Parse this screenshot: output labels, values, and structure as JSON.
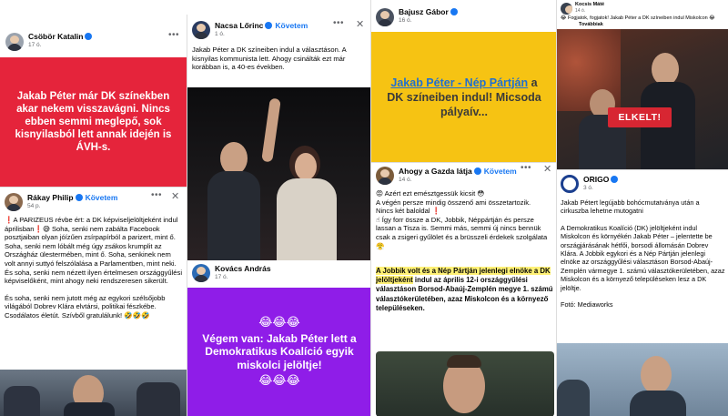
{
  "posts": {
    "csobor": {
      "author": "Csöbör Katalin",
      "time": "17 ó.",
      "card_text": "Jakab Péter már DK színekben akar nekem visszavágni. Nincs ebben semmi meglepő, sok kisnyilasból lett annak idején is ÁVH-s.",
      "card_color": "#e5243b"
    },
    "rakay": {
      "author": "Rákay Philip",
      "follow": "Követem",
      "time": "54 p.",
      "paragraphs": [
        "❗A PARIZEUS révbe ért: a DK képviseljelöltjeként indul áprilisban❗😅 Soha, senki nem zabálta Facebook posztjaiban olyan jóízűen zsírpapírból a parizert, mint ő. Soha, senki nem lóbált még úgy zsákos krumplit az Országház ülestermében, mint ő. Soha, senkinek nem volt annyi suttyó felszólalása a Parlamentben, mint neki. És soha, senki nem nézett ilyen értelmesen országgyűlési képviselőként, mint ahogy neki rendszeresen sikerült.",
        "És soha, senki nem jutott még az egykori szélsőjobb világából Dobrev Klára elvtársi, politikai fészkébe. Csodálatos életút. Szívből gratulálunk! 🤣🤣🤣"
      ]
    },
    "nacsa": {
      "author": "Nacsa Lőrinc",
      "follow": "Követem",
      "time": "1 ó.",
      "text": "Jakab Péter a DK színeiben indul a választáson. A kisnyilas kommunista lett. Ahogy csinálták ezt már korábban is, a 40-es években."
    },
    "kovacs": {
      "author": "Kovács András",
      "time": "17 ó.",
      "card_emoji_top": "😂😂😂",
      "card_text": "Végem van: Jakab Péter lett a Demokratikus Koalíció egyik miskolci jelöltje!",
      "card_emoji_bottom": "😂😂😂",
      "card_color": "#8f1de8"
    },
    "bajusz": {
      "author": "Bajusz Gábor",
      "time": "16 ó.",
      "card_part1": "Jakab Péter - Nép Pártján",
      "card_part2": " a DK színeiben indul! Micsoda pályaív...",
      "card_color": "#f6c313"
    },
    "gazda": {
      "author": "Ahogy a Gazda látja",
      "follow": "Követem",
      "time": "14 ó.",
      "lines": [
        "😡 Azért ezt emésztgessük kicsit 😳",
        "A végén persze mindig összenő ami összetartozik.",
        "Nincs két baloldal ❗",
        "☝ Így forr össze a DK, Jobbik, Néppártján és persze lassan a Tisza is. Semmi más, semmi új nincs bennük csak a zsigeri gyűlölet és a brüsszeli érdekek szolgálata 😤"
      ],
      "card_highlight": "A Jobbik volt és a Nép Pártján jelenlegi elnöke a DK jelöltjeként",
      "card_text": " indul az április 12-i országgyűlési választáson Borsod-Abaúj-Zemplén megye 1. számú választókerületében, azaz Miskolcon és a környező településeken."
    },
    "kocsis": {
      "author": "Kocsis Máté",
      "time": "14 ó.",
      "text": "😂 Fogjatok, fogjatok! Jakab Péter a DK színeiben indul Miskolcon 😂",
      "more": "Továbbiak",
      "photo_caption": "ELKELT!"
    },
    "origo": {
      "author": "ORIGO",
      "time": "3 ó.",
      "p1": "Jakab Pétert legújabb bohócmutatványa után a cirkuszba lehetne mutogatni",
      "p2": "A Demokratikus Koalíció (DK) jelöltjeként indul Miskolcon és környékén Jakab Péter – jelentette be országjárásának hétfői, borsodi állomásán Dobrev Klára. A Jobbik egykori és a Nép Pártján jelenlegi elnöke az országgyűlési választáson Borsod-Abaúj-Zemplén vármegye 1. számú választókerületében, azaz Miskolcon és a környező településeken lesz a DK jelöltje.",
      "credit": "Fotó: Mediaworks"
    }
  },
  "colors": {
    "accent": "#1877f2",
    "verified": "#1877f2",
    "muted": "#65676b"
  }
}
